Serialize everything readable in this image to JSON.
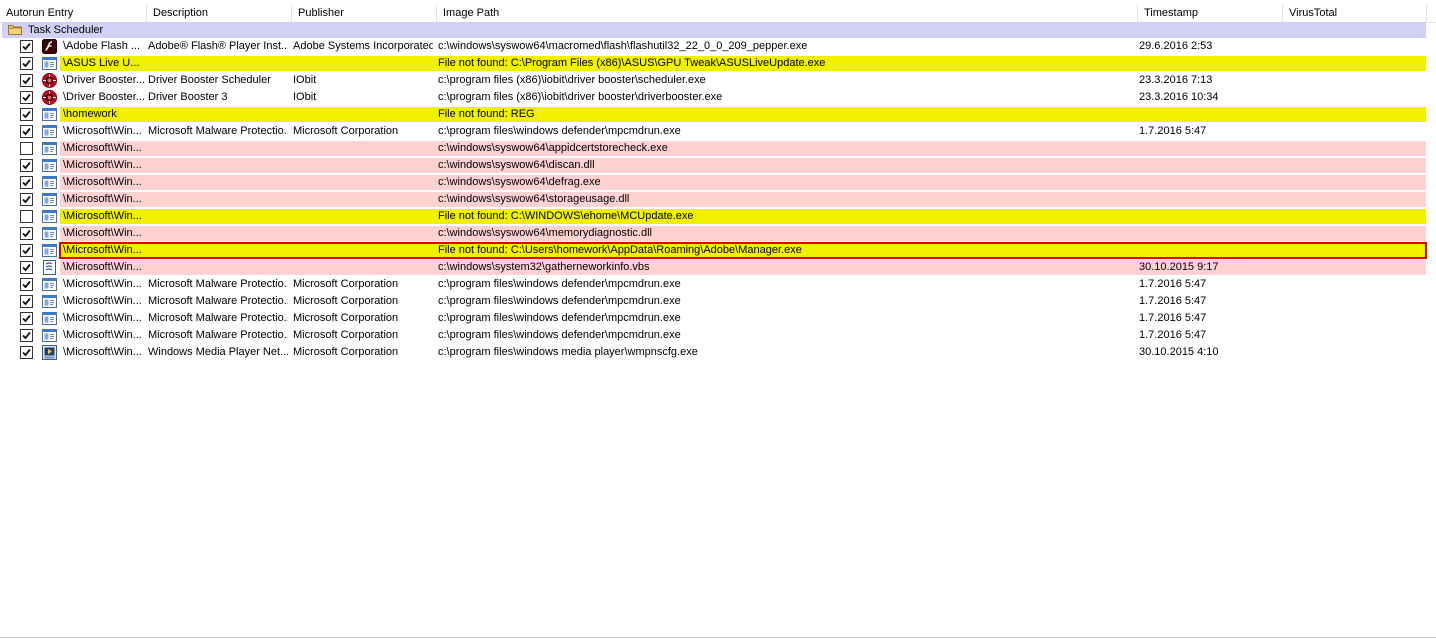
{
  "columns": {
    "entry": "Autorun Entry",
    "description": "Description",
    "publisher": "Publisher",
    "image_path": "Image Path",
    "timestamp": "Timestamp",
    "virustotal": "VirusTotal"
  },
  "group": {
    "label": "Task Scheduler",
    "icon": "folder-icon"
  },
  "colors": {
    "yellow": "#f0f000",
    "pink": "#ffd1d1",
    "group": "#d1d1f8",
    "selected_border": "#e00000"
  },
  "rows": [
    {
      "checked": true,
      "icon": "flash-icon",
      "highlight": "none",
      "entry": "\\Adobe Flash ...",
      "description": "Adobe® Flash® Player Inst...",
      "publisher": "Adobe Systems Incorporated",
      "path": "c:\\windows\\syswow64\\macromed\\flash\\flashutil32_22_0_0_209_pepper.exe",
      "timestamp": "29.6.2016 2:53"
    },
    {
      "checked": true,
      "icon": "app-window-icon",
      "highlight": "yellow",
      "entry": "\\ASUS Live U...",
      "description": "",
      "publisher": "",
      "path": "File not found: C:\\Program Files (x86)\\ASUS\\GPU Tweak\\ASUSLiveUpdate.exe",
      "timestamp": ""
    },
    {
      "checked": true,
      "icon": "driver-booster-icon",
      "highlight": "none",
      "entry": "\\Driver Booster...",
      "description": "Driver Booster Scheduler",
      "publisher": "IObit",
      "path": "c:\\program files (x86)\\iobit\\driver booster\\scheduler.exe",
      "timestamp": "23.3.2016 7:13"
    },
    {
      "checked": true,
      "icon": "driver-booster-icon",
      "highlight": "none",
      "entry": "\\Driver Booster...",
      "description": "Driver Booster 3",
      "publisher": "IObit",
      "path": "c:\\program files (x86)\\iobit\\driver booster\\driverbooster.exe",
      "timestamp": "23.3.2016 10:34"
    },
    {
      "checked": true,
      "icon": "app-window-icon",
      "highlight": "yellow",
      "entry": "\\homework",
      "description": "",
      "publisher": "",
      "path": "File not found: REG",
      "timestamp": ""
    },
    {
      "checked": true,
      "icon": "app-window-icon",
      "highlight": "none",
      "entry": "\\Microsoft\\Win...",
      "description": "Microsoft Malware Protectio...",
      "publisher": "Microsoft Corporation",
      "path": "c:\\program files\\windows defender\\mpcmdrun.exe",
      "timestamp": "1.7.2016 5:47"
    },
    {
      "checked": false,
      "icon": "app-window-icon",
      "highlight": "pink",
      "entry": "\\Microsoft\\Win...",
      "description": "",
      "publisher": "",
      "path": "c:\\windows\\syswow64\\appidcertstorecheck.exe",
      "timestamp": ""
    },
    {
      "checked": true,
      "icon": "app-window-icon",
      "highlight": "pink",
      "entry": "\\Microsoft\\Win...",
      "description": "",
      "publisher": "",
      "path": "c:\\windows\\syswow64\\discan.dll",
      "timestamp": ""
    },
    {
      "checked": true,
      "icon": "app-window-icon",
      "highlight": "pink",
      "entry": "\\Microsoft\\Win...",
      "description": "",
      "publisher": "",
      "path": "c:\\windows\\syswow64\\defrag.exe",
      "timestamp": ""
    },
    {
      "checked": true,
      "icon": "app-window-icon",
      "highlight": "pink",
      "entry": "\\Microsoft\\Win...",
      "description": "",
      "publisher": "",
      "path": "c:\\windows\\syswow64\\storageusage.dll",
      "timestamp": ""
    },
    {
      "checked": false,
      "icon": "app-window-icon",
      "highlight": "yellow",
      "entry": "\\Microsoft\\Win...",
      "description": "",
      "publisher": "",
      "path": "File not found: C:\\WINDOWS\\ehome\\MCUpdate.exe",
      "timestamp": ""
    },
    {
      "checked": true,
      "icon": "app-window-icon",
      "highlight": "pink",
      "entry": "\\Microsoft\\Win...",
      "description": "",
      "publisher": "",
      "path": "c:\\windows\\syswow64\\memorydiagnostic.dll",
      "timestamp": ""
    },
    {
      "checked": true,
      "icon": "app-window-icon",
      "highlight": "yellow",
      "selected": true,
      "entry": "\\Microsoft\\Win...",
      "description": "",
      "publisher": "",
      "path": "File not found: C:\\Users\\homework\\AppData\\Roaming\\Adobe\\Manager.exe",
      "timestamp": ""
    },
    {
      "checked": true,
      "icon": "script-icon",
      "highlight": "pink",
      "entry": "\\Microsoft\\Win...",
      "description": "",
      "publisher": "",
      "path": "c:\\windows\\system32\\gatherneworkinfo.vbs",
      "timestamp": "30.10.2015 9:17"
    },
    {
      "checked": true,
      "icon": "app-window-icon",
      "highlight": "none",
      "entry": "\\Microsoft\\Win...",
      "description": "Microsoft Malware Protectio...",
      "publisher": "Microsoft Corporation",
      "path": "c:\\program files\\windows defender\\mpcmdrun.exe",
      "timestamp": "1.7.2016 5:47"
    },
    {
      "checked": true,
      "icon": "app-window-icon",
      "highlight": "none",
      "entry": "\\Microsoft\\Win...",
      "description": "Microsoft Malware Protectio...",
      "publisher": "Microsoft Corporation",
      "path": "c:\\program files\\windows defender\\mpcmdrun.exe",
      "timestamp": "1.7.2016 5:47"
    },
    {
      "checked": true,
      "icon": "app-window-icon",
      "highlight": "none",
      "entry": "\\Microsoft\\Win...",
      "description": "Microsoft Malware Protectio...",
      "publisher": "Microsoft Corporation",
      "path": "c:\\program files\\windows defender\\mpcmdrun.exe",
      "timestamp": "1.7.2016 5:47"
    },
    {
      "checked": true,
      "icon": "app-window-icon",
      "highlight": "none",
      "entry": "\\Microsoft\\Win...",
      "description": "Microsoft Malware Protectio...",
      "publisher": "Microsoft Corporation",
      "path": "c:\\program files\\windows defender\\mpcmdrun.exe",
      "timestamp": "1.7.2016 5:47"
    },
    {
      "checked": true,
      "icon": "media-player-icon",
      "highlight": "none",
      "entry": "\\Microsoft\\Win...",
      "description": "Windows Media Player Net...",
      "publisher": "Microsoft Corporation",
      "path": "c:\\program files\\windows media player\\wmpnscfg.exe",
      "timestamp": "30.10.2015 4:10"
    }
  ]
}
